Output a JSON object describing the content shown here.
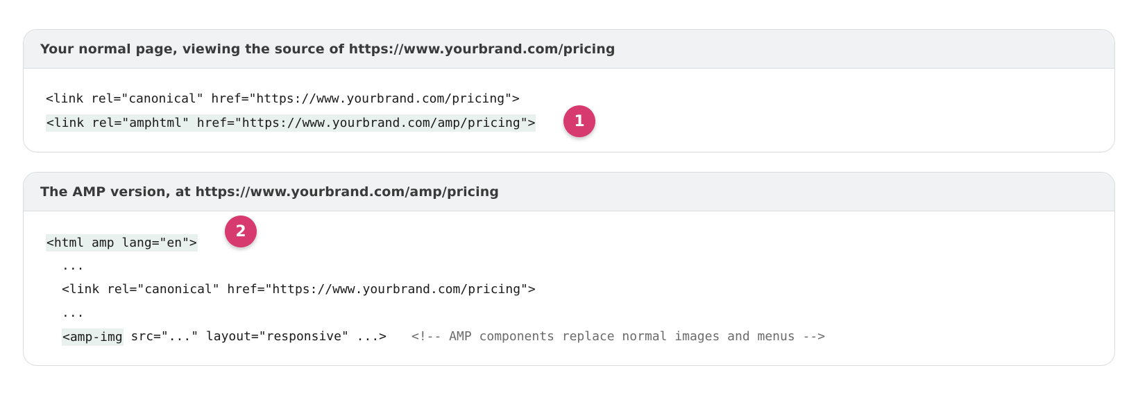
{
  "colors": {
    "badge": "#d63a6e",
    "header_background": "#f1f2f3",
    "highlight": "#e8f1ee",
    "border": "#d9dcdf"
  },
  "cards": [
    {
      "title": "Your normal page, viewing the source of https://www.yourbrand.com/pricing",
      "lines": [
        {
          "text": "<link rel=\"canonical\" href=\"https://www.yourbrand.com/pricing\">"
        },
        {
          "highlighted": "<link rel=\"amphtml\" href=\"https://www.yourbrand.com/amp/pricing\">"
        }
      ],
      "badge": "1"
    },
    {
      "title": "The AMP version, at https://www.yourbrand.com/amp/pricing",
      "lines": [
        {
          "highlighted": "<html amp lang=\"en\">"
        },
        {
          "text": "..."
        },
        {
          "text": "<link rel=\"canonical\" href=\"https://www.yourbrand.com/pricing\">"
        },
        {
          "text": "..."
        },
        {
          "highlighted": "<amp-img",
          "text": " src=\"...\" layout=\"responsive\" ...>",
          "comment": "<!-- AMP components replace normal images and menus -->"
        }
      ],
      "badge": "2"
    }
  ]
}
